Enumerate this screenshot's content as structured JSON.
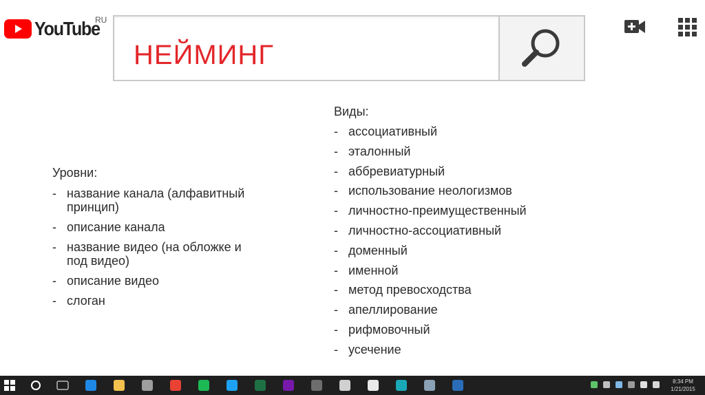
{
  "header": {
    "logo_text": "YouTube",
    "region": "RU",
    "brand_color": "#ff0000"
  },
  "search": {
    "value": "НЕЙМИНГ",
    "text_color": "#e3262a",
    "button_icon": "search-icon"
  },
  "top_icons": [
    "video-add-icon",
    "apps-grid-icon"
  ],
  "left_column": {
    "heading": "Уровни:",
    "items": [
      "название канала (алфавитный принцип)",
      "описание канала",
      "название видео (на обложке и под видео)",
      "описание видео",
      "слоган"
    ]
  },
  "right_column": {
    "heading": "Виды:",
    "items": [
      "ассоциативный",
      "эталонный",
      "аббревиатурный",
      "использование неологизмов",
      "личностно-преимущественный",
      "личностно-ассоциативный",
      "доменный",
      "именной",
      "метод превосходства",
      "апеллирование",
      "рифмовочный",
      "усечение"
    ]
  },
  "taskbar": {
    "pinned_icons": [
      {
        "name": "edge-icon",
        "color": "#1e88e5"
      },
      {
        "name": "file-explorer-icon",
        "color": "#f2c14e"
      },
      {
        "name": "store-icon",
        "color": "#9e9e9e"
      },
      {
        "name": "chrome-icon",
        "color": "#e94235"
      },
      {
        "name": "spotify-icon",
        "color": "#1db954"
      },
      {
        "name": "twitter-icon",
        "color": "#1da1f2"
      },
      {
        "name": "excel-icon",
        "color": "#1e7145"
      },
      {
        "name": "onenote-icon",
        "color": "#7719aa"
      },
      {
        "name": "photos-icon",
        "color": "#6d6d6d"
      },
      {
        "name": "xbox-icon",
        "color": "#d0d0d0"
      },
      {
        "name": "mail-icon",
        "color": "#eaeaea"
      },
      {
        "name": "app-n-icon",
        "color": "#1aa9b7"
      },
      {
        "name": "network-icon",
        "color": "#8aa0b4"
      },
      {
        "name": "photoshop-icon",
        "color": "#2a6cb8"
      }
    ],
    "clock_time": "8:34 PM",
    "clock_date": "1/21/2015"
  }
}
